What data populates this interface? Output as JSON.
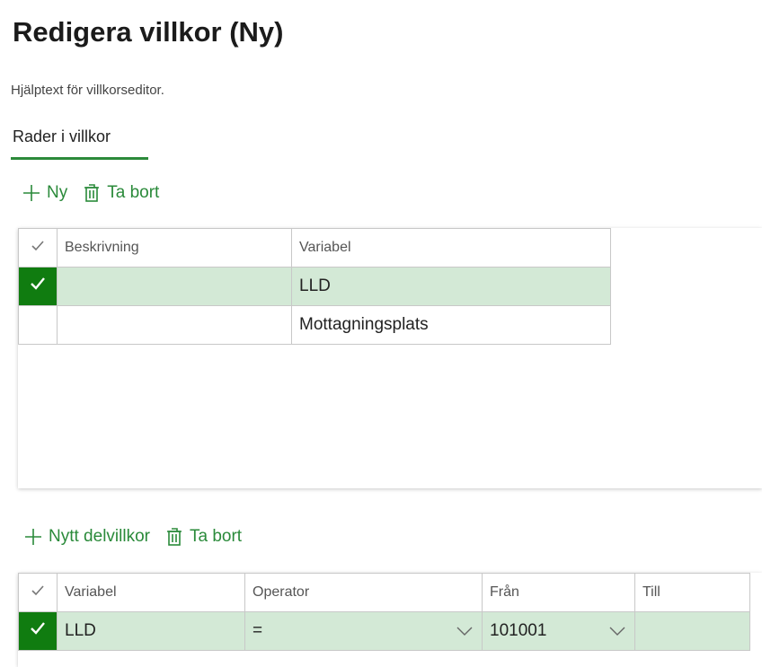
{
  "page": {
    "title": "Redigera villkor (Ny)",
    "help_text": "Hjälptext för villkorseditor.",
    "tab_label": "Rader i villkor"
  },
  "toolbar1": {
    "new_label": "Ny",
    "delete_label": "Ta bort"
  },
  "grid1": {
    "headers": [
      "Beskrivning",
      "Variabel"
    ],
    "rows": [
      {
        "selected": true,
        "beskrivning": "",
        "variabel": "LLD"
      },
      {
        "selected": false,
        "beskrivning": "",
        "variabel": "Mottagningsplats"
      }
    ]
  },
  "toolbar2": {
    "new_label": "Nytt delvillkor",
    "delete_label": "Ta bort"
  },
  "grid2": {
    "headers": [
      "Variabel",
      "Operator",
      "Från",
      "Till"
    ],
    "rows": [
      {
        "selected": true,
        "variabel": "LLD",
        "operator": "=",
        "fran": "101001",
        "till": ""
      }
    ]
  },
  "colors": {
    "accent": "#2a8a3a",
    "selected_row": "#d3e9d6",
    "check_fill": "#107c10"
  }
}
